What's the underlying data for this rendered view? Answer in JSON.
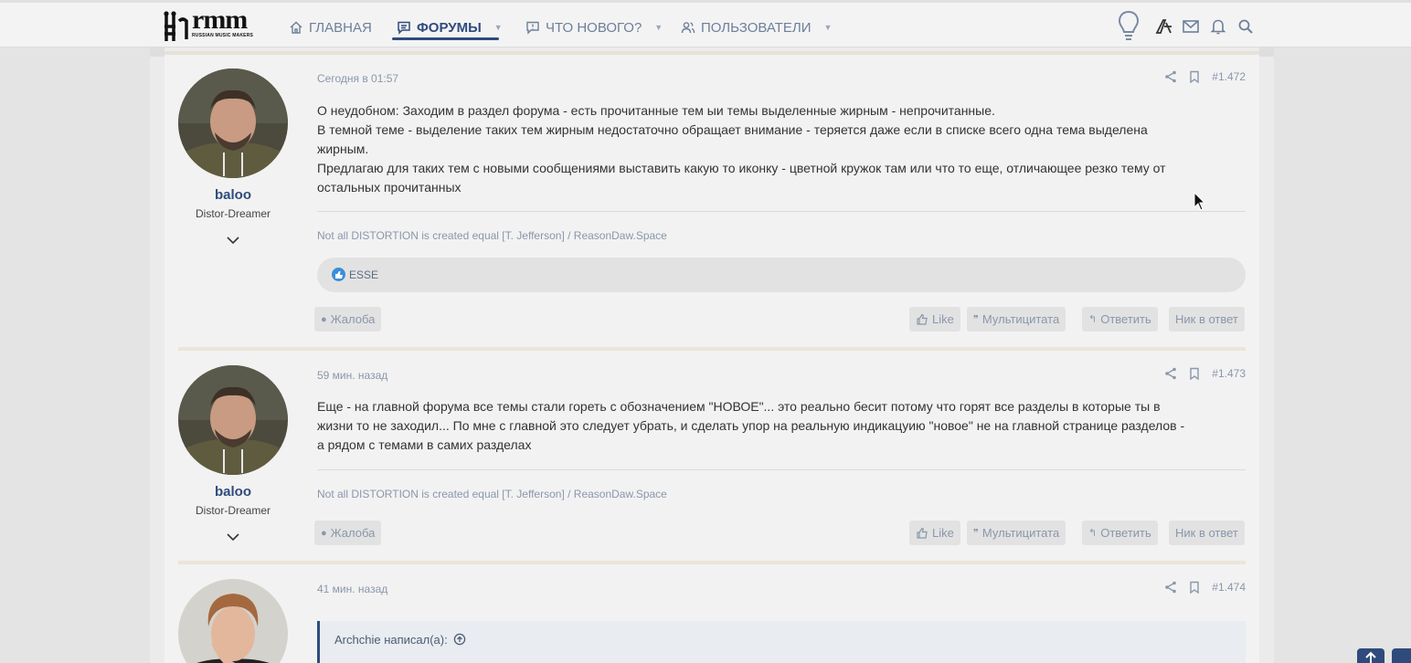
{
  "site": {
    "logo_text": "rmm",
    "logo_sub": "RUSSIAN MUSIC MAKERS"
  },
  "nav": {
    "home": "ГЛАВНАЯ",
    "forums": "ФОРУМЫ",
    "whats_new": "ЧТО НОВОГО?",
    "users": "ПОЛЬЗОВАТЕЛИ"
  },
  "posts": [
    {
      "date": "Сегодня в 01:57",
      "number": "#1.472",
      "username": "baloo",
      "user_title": "Distor-Dreamer",
      "lines": [
        "О неудобном: Заходим в раздел форума - есть прочитанные тем ыи темы выделенные жирным - непрочитанные.",
        "В темной теме - выделение таких тем жирным недостаточно обращает внимание - теряется даже если в списке всего одна тема выделена",
        "жирным.",
        "Предлагаю для таких тем с новыми сообщениями выставить какую то иконку - цветной кружок там или что то еще, отличающее резко тему от",
        "остальных прочитанных"
      ],
      "signature": "Not all DISTORTION is created equal [T. Jefferson] / ReasonDaw.Space",
      "reaction_user": "ESSE"
    },
    {
      "date": "59 мин. назад",
      "number": "#1.473",
      "username": "baloo",
      "user_title": "Distor-Dreamer",
      "lines": [
        "Еще - на главной форума все темы стали гореть с обозначением \"НОВОЕ\"... это реально бесит потому что горят все разделы в которые ты в",
        "жизни то не заходил... По мне с главной это следует убрать, и сделать упор на реальную индикацуию \"новое\" не на главной странице разделов -",
        "а рядом с темами в самих разделах"
      ],
      "signature": "Not all DISTORTION is created equal [T. Jefferson] / ReasonDaw.Space"
    },
    {
      "date": "41 мин. назад",
      "number": "#1.474",
      "quote_author": "Archchie написал(а):"
    }
  ],
  "actions": {
    "report": "Жалоба",
    "like": "Like",
    "multiquote": "Мультицитата",
    "reply": "Ответить",
    "nick_reply": "Ник в ответ"
  },
  "colors": {
    "accent": "#2f4b7c",
    "muted": "#8a97ab",
    "reaction_like": "#3a8edb"
  },
  "icons": [
    "home-icon",
    "forum-icon",
    "whats-new-icon",
    "users-icon",
    "idea-icon",
    "brand-icon",
    "mail-icon",
    "bell-icon",
    "search-icon",
    "share-icon",
    "bookmark-icon",
    "chevron-down-icon",
    "like-icon",
    "quote-icon",
    "reply-icon",
    "report-icon",
    "arrow-up-icon"
  ]
}
